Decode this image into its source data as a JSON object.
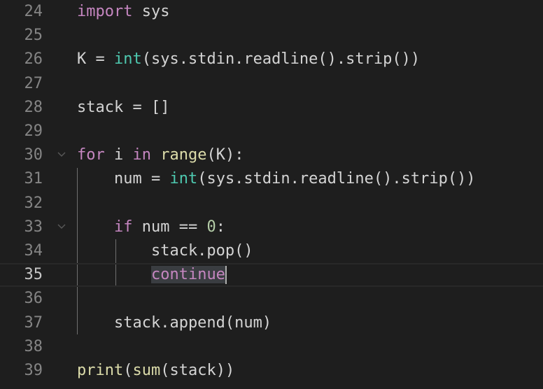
{
  "editor": {
    "lines": [
      {
        "number": "24",
        "tokens": [
          {
            "t": "import",
            "c": "keyword"
          },
          {
            "t": " sys",
            "c": "plain"
          }
        ]
      },
      {
        "number": "25",
        "tokens": []
      },
      {
        "number": "26",
        "tokens": [
          {
            "t": "K = ",
            "c": "plain"
          },
          {
            "t": "int",
            "c": "builtin"
          },
          {
            "t": "(sys.stdin.readline().strip())",
            "c": "plain"
          }
        ]
      },
      {
        "number": "27",
        "tokens": []
      },
      {
        "number": "28",
        "tokens": [
          {
            "t": "stack = []",
            "c": "plain"
          }
        ]
      },
      {
        "number": "29",
        "tokens": []
      },
      {
        "number": "30",
        "fold": true,
        "tokens": [
          {
            "t": "for",
            "c": "keyword"
          },
          {
            "t": " i ",
            "c": "plain"
          },
          {
            "t": "in",
            "c": "keyword"
          },
          {
            "t": " ",
            "c": "plain"
          },
          {
            "t": "range",
            "c": "func"
          },
          {
            "t": "(K):",
            "c": "plain"
          }
        ]
      },
      {
        "number": "31",
        "tokens": [
          {
            "t": "    num = ",
            "c": "plain"
          },
          {
            "t": "int",
            "c": "builtin"
          },
          {
            "t": "(sys.stdin.readline().strip())",
            "c": "plain"
          }
        ]
      },
      {
        "number": "32",
        "tokens": []
      },
      {
        "number": "33",
        "fold": true,
        "tokens": [
          {
            "t": "    ",
            "c": "plain"
          },
          {
            "t": "if",
            "c": "keyword"
          },
          {
            "t": " num == ",
            "c": "plain"
          },
          {
            "t": "0",
            "c": "number"
          },
          {
            "t": ":",
            "c": "plain"
          }
        ]
      },
      {
        "number": "34",
        "tokens": [
          {
            "t": "        stack.pop()",
            "c": "plain"
          }
        ]
      },
      {
        "number": "35",
        "current": true,
        "tokens": [
          {
            "t": "        ",
            "c": "plain"
          },
          {
            "t": "continue",
            "c": "keyword",
            "highlight": true
          }
        ]
      },
      {
        "number": "36",
        "tokens": []
      },
      {
        "number": "37",
        "tokens": [
          {
            "t": "    stack.append(num)",
            "c": "plain"
          }
        ]
      },
      {
        "number": "38",
        "tokens": []
      },
      {
        "number": "39",
        "tokens": [
          {
            "t": "print",
            "c": "func"
          },
          {
            "t": "(",
            "c": "plain"
          },
          {
            "t": "sum",
            "c": "func"
          },
          {
            "t": "(stack))",
            "c": "plain"
          }
        ]
      }
    ],
    "icons": {
      "fold": "chevron-down-icon"
    },
    "colors": {
      "background": "#1e1e1e",
      "keyword": "#c586c0",
      "builtin": "#4ec9b0",
      "function": "#dcdcaa",
      "number": "#b5cea8",
      "text": "#d4d4d4",
      "line_number": "#858585"
    }
  }
}
